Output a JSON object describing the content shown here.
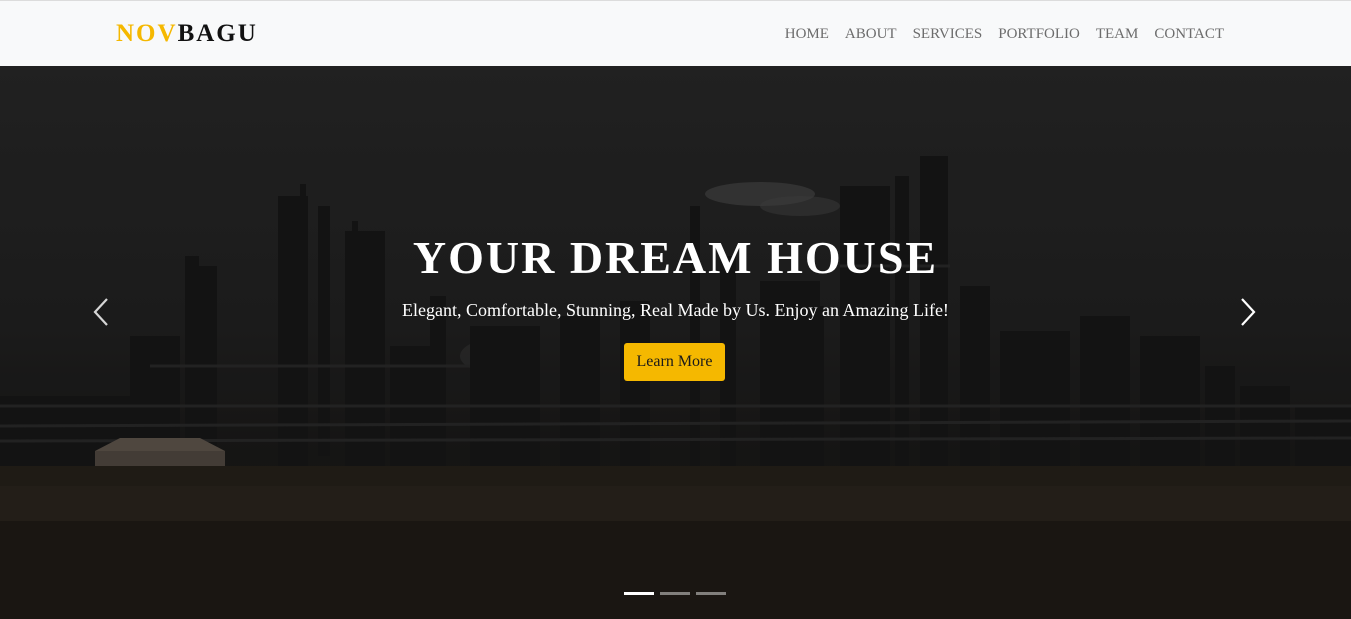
{
  "brand": {
    "part1": "NOV",
    "part2": "BAGU"
  },
  "nav": {
    "items": [
      {
        "label": "HOME"
      },
      {
        "label": "ABOUT"
      },
      {
        "label": "SERVICES"
      },
      {
        "label": "PORTFOLIO"
      },
      {
        "label": "TEAM"
      },
      {
        "label": "CONTACT"
      }
    ]
  },
  "hero": {
    "title": "YOUR DREAM HOUSE",
    "subtitle": "Elegant, Comfortable, Stunning, Real Made by Us. Enjoy an Amazing Life!",
    "cta_label": "Learn More",
    "background_icon": "industrial-refinery-photo",
    "prev_icon": "chevron-left-icon",
    "next_icon": "chevron-right-icon"
  },
  "carousel": {
    "slide_count": 3,
    "active_index": 0
  },
  "colors": {
    "accent": "#f5b800",
    "navbar_bg": "#f8f9fa",
    "nav_text": "#6c6c6c",
    "hero_text": "#ffffff"
  }
}
